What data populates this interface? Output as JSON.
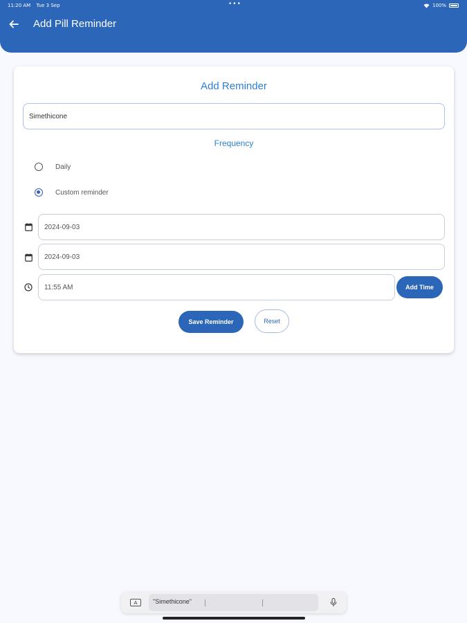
{
  "status_bar": {
    "time": "11:20 AM",
    "date": "Tue 3 Sep",
    "dots": "•••",
    "battery": "100%"
  },
  "app_bar": {
    "title": "Add Pill Reminder"
  },
  "card": {
    "title": "Add Reminder",
    "medicine_name": "Simethicone",
    "frequency_label": "Frequency",
    "options": [
      {
        "label": "Daily",
        "selected": false
      },
      {
        "label": "Custom reminder",
        "selected": true
      }
    ],
    "start_date": "2024-09-03",
    "end_date": "2024-09-03",
    "time": "11:55 AM",
    "add_time_label": "Add Time",
    "save_label": "Save Reminder",
    "reset_label": "Reset"
  },
  "keyboard": {
    "key_icon_label": "A",
    "suggestion": "\"Simethicone\""
  },
  "colors": {
    "primary": "#2c66b8",
    "accent_text": "#2a7fd4",
    "background": "#f8f9fe"
  }
}
